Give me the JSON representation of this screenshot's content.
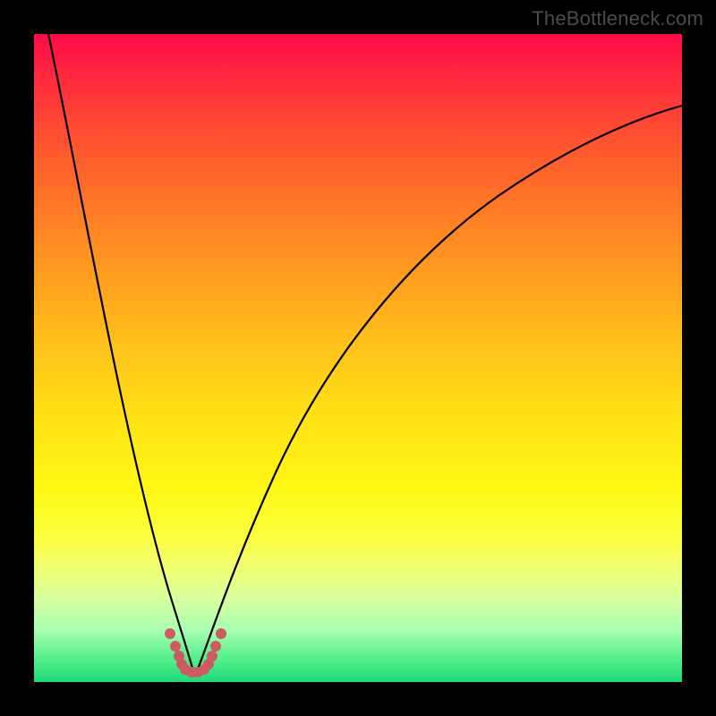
{
  "watermark": "TheBottleneck.com",
  "chart_data": {
    "type": "line",
    "title": "",
    "xlabel": "",
    "ylabel": "",
    "xlim": [
      0,
      100
    ],
    "ylim": [
      0,
      100
    ],
    "background_gradient_stops": [
      {
        "pos": 0,
        "color": "#ff0b47"
      },
      {
        "pos": 14,
        "color": "#ff4933"
      },
      {
        "pos": 36,
        "color": "#ff9920"
      },
      {
        "pos": 60,
        "color": "#ffe416"
      },
      {
        "pos": 77,
        "color": "#fcff3a"
      },
      {
        "pos": 92,
        "color": "#a8ffb1"
      },
      {
        "pos": 100,
        "color": "#1eda77"
      }
    ],
    "series": [
      {
        "name": "left-curve",
        "x": [
          2,
          4,
          6,
          8,
          10,
          12,
          14,
          16,
          18,
          20,
          22,
          23
        ],
        "y": [
          100,
          90,
          80,
          70,
          60,
          50,
          40,
          30,
          20,
          10,
          3,
          0
        ]
      },
      {
        "name": "right-curve",
        "x": [
          27,
          29,
          32,
          36,
          41,
          47,
          54,
          62,
          71,
          81,
          92,
          100
        ],
        "y": [
          0,
          5,
          12,
          22,
          33,
          44,
          54,
          63,
          71,
          78,
          84,
          88
        ]
      }
    ],
    "valley_markers": {
      "name": "valley-dots",
      "color": "#cc5b63",
      "points": [
        {
          "x": 21.0,
          "y": 7.5
        },
        {
          "x": 21.8,
          "y": 5.5
        },
        {
          "x": 22.3,
          "y": 4.0
        },
        {
          "x": 22.8,
          "y": 2.8
        },
        {
          "x": 23.4,
          "y": 2.0
        },
        {
          "x": 24.3,
          "y": 1.6
        },
        {
          "x": 25.3,
          "y": 1.6
        },
        {
          "x": 26.2,
          "y": 2.0
        },
        {
          "x": 26.9,
          "y": 2.8
        },
        {
          "x": 27.5,
          "y": 4.0
        },
        {
          "x": 28.1,
          "y": 5.5
        },
        {
          "x": 28.9,
          "y": 7.5
        }
      ]
    }
  }
}
